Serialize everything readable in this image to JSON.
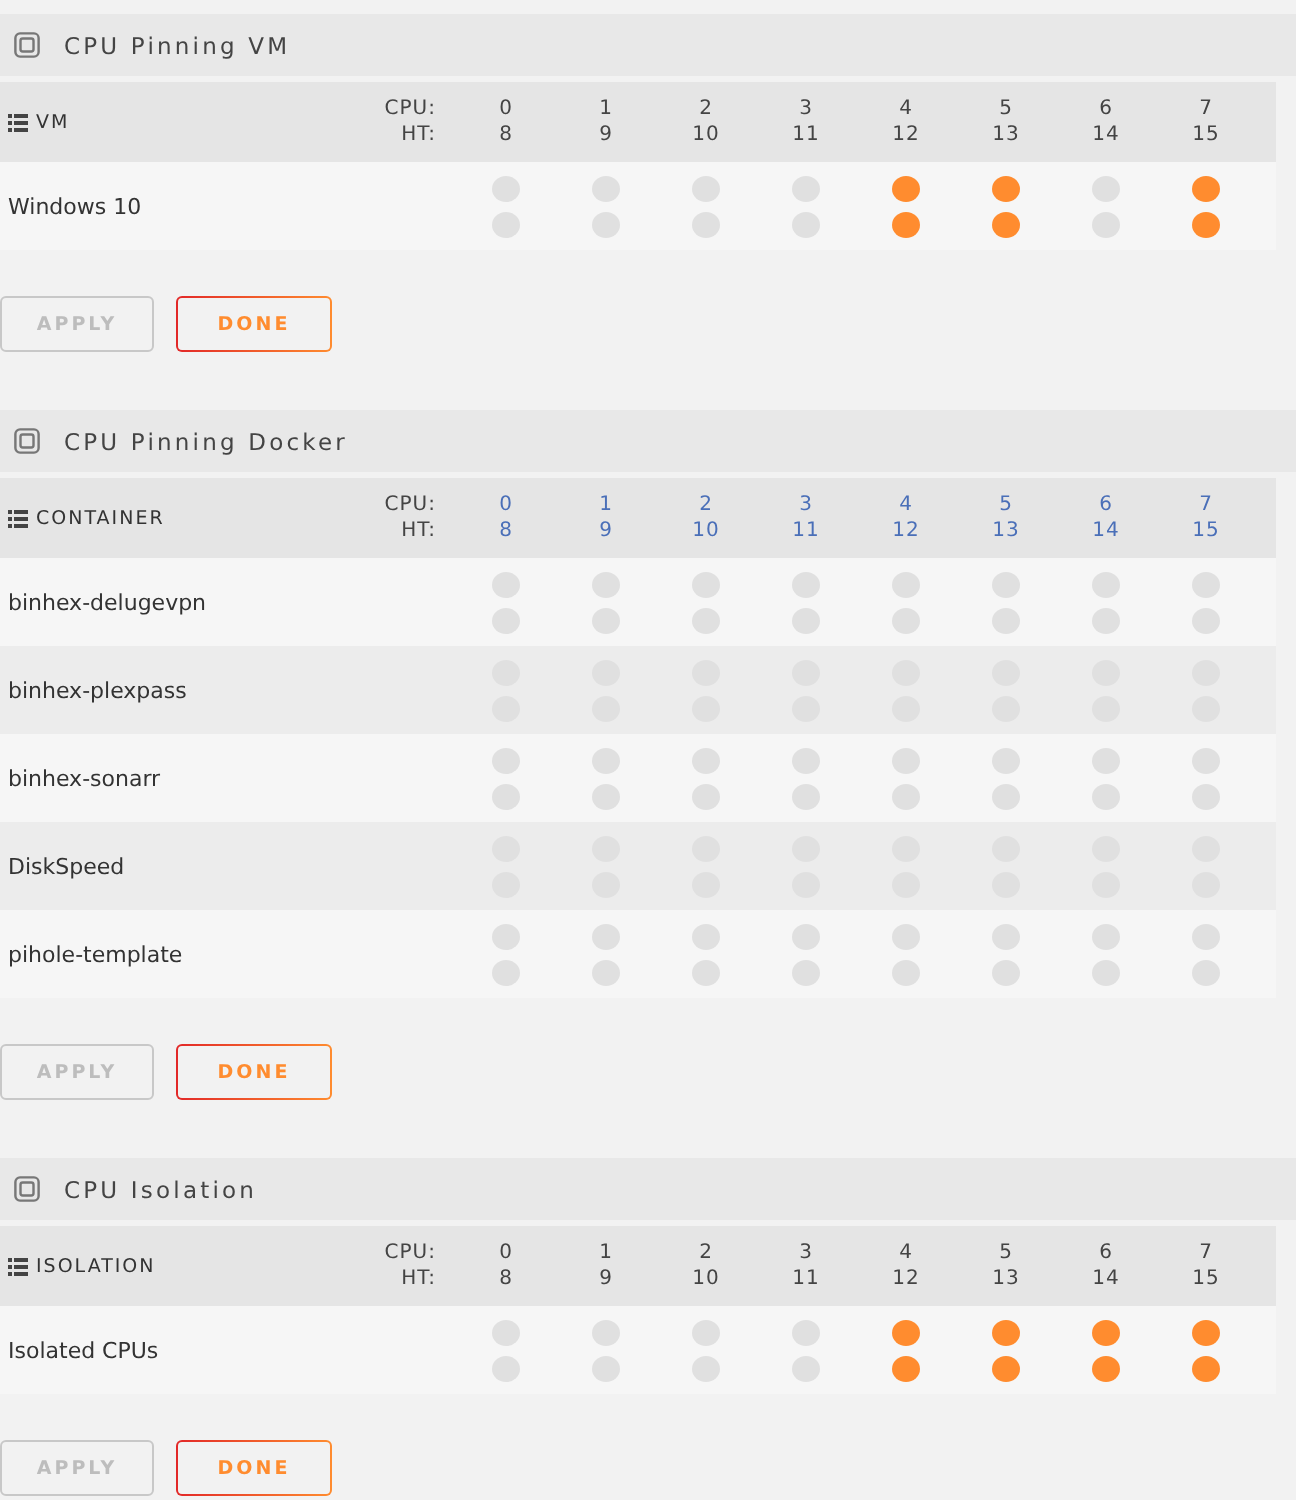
{
  "sections": [
    {
      "title": "CPU Pinning VM",
      "column_heading": "VM",
      "cpu_label": "CPU:",
      "ht_label": "HT:",
      "cores_clickable": false,
      "cores": [
        {
          "cpu": "0",
          "ht": "8"
        },
        {
          "cpu": "1",
          "ht": "9"
        },
        {
          "cpu": "2",
          "ht": "10"
        },
        {
          "cpu": "3",
          "ht": "11"
        },
        {
          "cpu": "4",
          "ht": "12"
        },
        {
          "cpu": "5",
          "ht": "13"
        },
        {
          "cpu": "6",
          "ht": "14"
        },
        {
          "cpu": "7",
          "ht": "15"
        }
      ],
      "rows": [
        {
          "name": "Windows 10",
          "pins": [
            {
              "cpu_checked": false,
              "ht_checked": false
            },
            {
              "cpu_checked": false,
              "ht_checked": false
            },
            {
              "cpu_checked": false,
              "ht_checked": false
            },
            {
              "cpu_checked": false,
              "ht_checked": false
            },
            {
              "cpu_checked": true,
              "ht_checked": true
            },
            {
              "cpu_checked": true,
              "ht_checked": true
            },
            {
              "cpu_checked": false,
              "ht_checked": false
            },
            {
              "cpu_checked": true,
              "ht_checked": true
            }
          ]
        }
      ],
      "buttons": [
        {
          "label": "APPLY",
          "disabled": true
        },
        {
          "label": "DONE",
          "disabled": false
        }
      ]
    },
    {
      "title": "CPU Pinning Docker",
      "column_heading": "CONTAINER",
      "cpu_label": "CPU:",
      "ht_label": "HT:",
      "cores_clickable": true,
      "cores": [
        {
          "cpu": "0",
          "ht": "8"
        },
        {
          "cpu": "1",
          "ht": "9"
        },
        {
          "cpu": "2",
          "ht": "10"
        },
        {
          "cpu": "3",
          "ht": "11"
        },
        {
          "cpu": "4",
          "ht": "12"
        },
        {
          "cpu": "5",
          "ht": "13"
        },
        {
          "cpu": "6",
          "ht": "14"
        },
        {
          "cpu": "7",
          "ht": "15"
        }
      ],
      "rows": [
        {
          "name": "binhex-delugevpn",
          "pins": [
            {
              "cpu_checked": false,
              "ht_checked": false
            },
            {
              "cpu_checked": false,
              "ht_checked": false
            },
            {
              "cpu_checked": false,
              "ht_checked": false
            },
            {
              "cpu_checked": false,
              "ht_checked": false
            },
            {
              "cpu_checked": false,
              "ht_checked": false
            },
            {
              "cpu_checked": false,
              "ht_checked": false
            },
            {
              "cpu_checked": false,
              "ht_checked": false
            },
            {
              "cpu_checked": false,
              "ht_checked": false
            }
          ]
        },
        {
          "name": "binhex-plexpass",
          "pins": [
            {
              "cpu_checked": false,
              "ht_checked": false
            },
            {
              "cpu_checked": false,
              "ht_checked": false
            },
            {
              "cpu_checked": false,
              "ht_checked": false
            },
            {
              "cpu_checked": false,
              "ht_checked": false
            },
            {
              "cpu_checked": false,
              "ht_checked": false
            },
            {
              "cpu_checked": false,
              "ht_checked": false
            },
            {
              "cpu_checked": false,
              "ht_checked": false
            },
            {
              "cpu_checked": false,
              "ht_checked": false
            }
          ]
        },
        {
          "name": "binhex-sonarr",
          "pins": [
            {
              "cpu_checked": false,
              "ht_checked": false
            },
            {
              "cpu_checked": false,
              "ht_checked": false
            },
            {
              "cpu_checked": false,
              "ht_checked": false
            },
            {
              "cpu_checked": false,
              "ht_checked": false
            },
            {
              "cpu_checked": false,
              "ht_checked": false
            },
            {
              "cpu_checked": false,
              "ht_checked": false
            },
            {
              "cpu_checked": false,
              "ht_checked": false
            },
            {
              "cpu_checked": false,
              "ht_checked": false
            }
          ]
        },
        {
          "name": "DiskSpeed",
          "pins": [
            {
              "cpu_checked": false,
              "ht_checked": false
            },
            {
              "cpu_checked": false,
              "ht_checked": false
            },
            {
              "cpu_checked": false,
              "ht_checked": false
            },
            {
              "cpu_checked": false,
              "ht_checked": false
            },
            {
              "cpu_checked": false,
              "ht_checked": false
            },
            {
              "cpu_checked": false,
              "ht_checked": false
            },
            {
              "cpu_checked": false,
              "ht_checked": false
            },
            {
              "cpu_checked": false,
              "ht_checked": false
            }
          ]
        },
        {
          "name": "pihole-template",
          "pins": [
            {
              "cpu_checked": false,
              "ht_checked": false
            },
            {
              "cpu_checked": false,
              "ht_checked": false
            },
            {
              "cpu_checked": false,
              "ht_checked": false
            },
            {
              "cpu_checked": false,
              "ht_checked": false
            },
            {
              "cpu_checked": false,
              "ht_checked": false
            },
            {
              "cpu_checked": false,
              "ht_checked": false
            },
            {
              "cpu_checked": false,
              "ht_checked": false
            },
            {
              "cpu_checked": false,
              "ht_checked": false
            }
          ]
        }
      ],
      "buttons": [
        {
          "label": "APPLY",
          "disabled": true
        },
        {
          "label": "DONE",
          "disabled": false
        }
      ]
    },
    {
      "title": "CPU Isolation",
      "column_heading": "ISOLATION",
      "cpu_label": "CPU:",
      "ht_label": "HT:",
      "cores_clickable": false,
      "cores": [
        {
          "cpu": "0",
          "ht": "8"
        },
        {
          "cpu": "1",
          "ht": "9"
        },
        {
          "cpu": "2",
          "ht": "10"
        },
        {
          "cpu": "3",
          "ht": "11"
        },
        {
          "cpu": "4",
          "ht": "12"
        },
        {
          "cpu": "5",
          "ht": "13"
        },
        {
          "cpu": "6",
          "ht": "14"
        },
        {
          "cpu": "7",
          "ht": "15"
        }
      ],
      "rows": [
        {
          "name": "Isolated CPUs",
          "pins": [
            {
              "cpu_checked": false,
              "ht_checked": false
            },
            {
              "cpu_checked": false,
              "ht_checked": false
            },
            {
              "cpu_checked": false,
              "ht_checked": false
            },
            {
              "cpu_checked": false,
              "ht_checked": false
            },
            {
              "cpu_checked": true,
              "ht_checked": true
            },
            {
              "cpu_checked": true,
              "ht_checked": true
            },
            {
              "cpu_checked": true,
              "ht_checked": true
            },
            {
              "cpu_checked": true,
              "ht_checked": true
            }
          ]
        }
      ],
      "buttons": [
        {
          "label": "APPLY",
          "disabled": true
        },
        {
          "label": "DONE",
          "disabled": false
        }
      ]
    }
  ]
}
